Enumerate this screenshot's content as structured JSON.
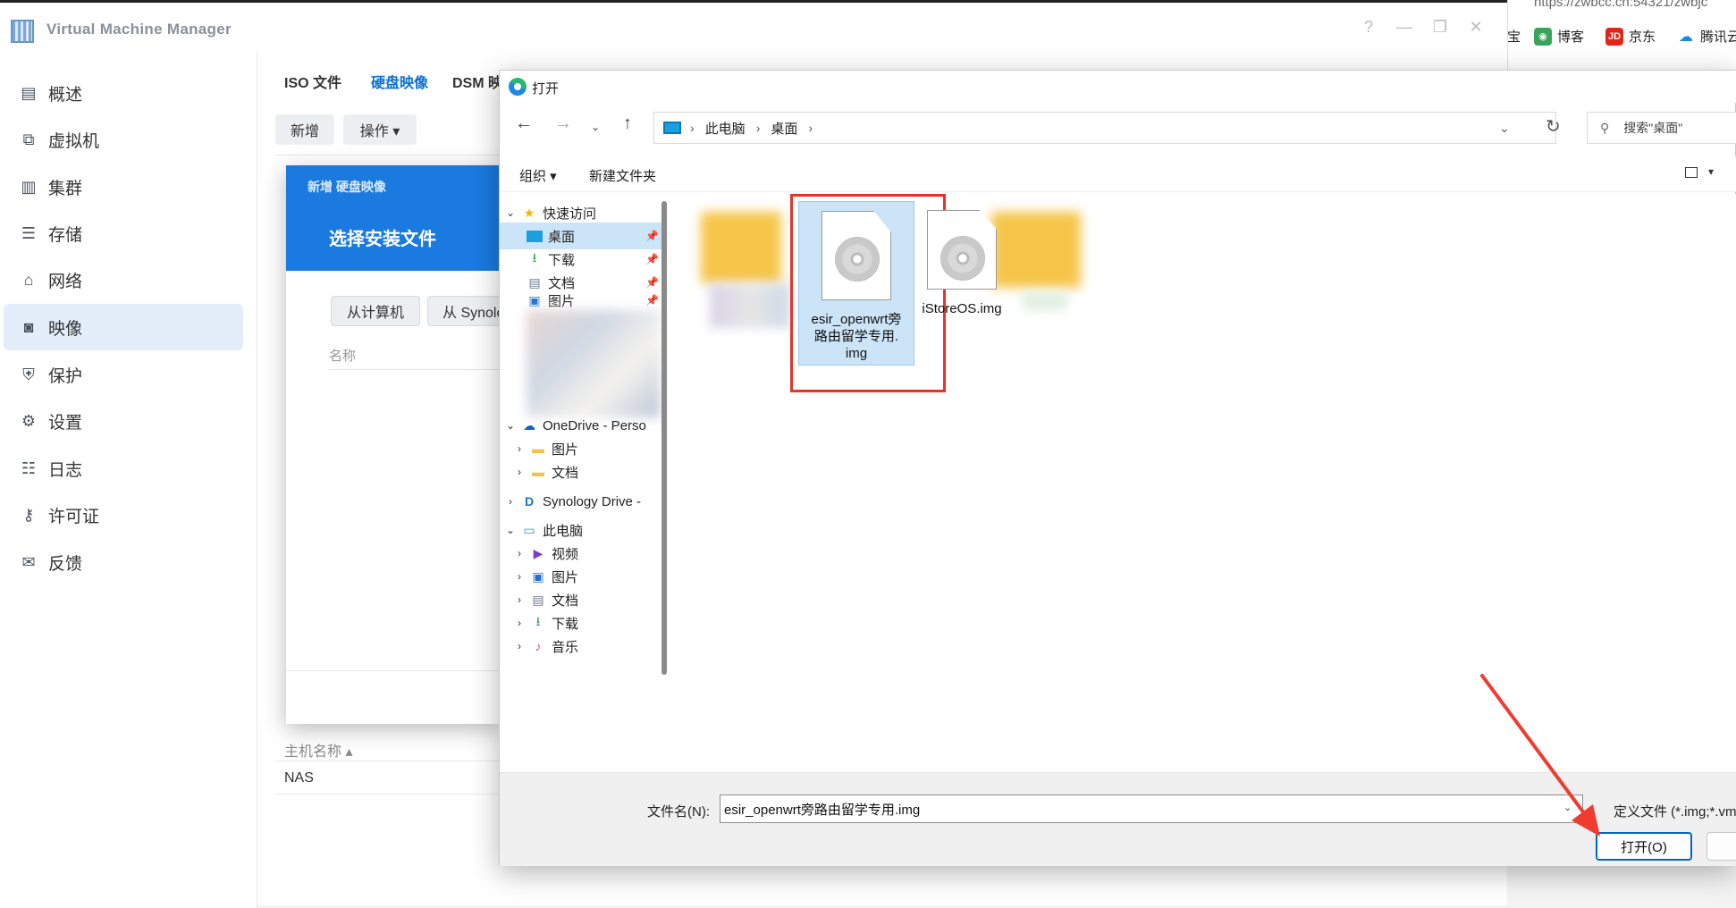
{
  "browser": {
    "url": "https://zwbcc.cn:54321/zwbjc",
    "bookmarks": [
      {
        "label": "宝",
        "icon": "bookmark-icon"
      },
      {
        "label": "博客",
        "icon": "cnblogs-icon"
      },
      {
        "label": "京东",
        "icon": "jd-icon",
        "badge": "JD"
      },
      {
        "label": "腾讯云",
        "icon": "tencent-cloud-icon"
      }
    ]
  },
  "vmm": {
    "title": "Virtual Machine Manager",
    "window_buttons": [
      "?",
      "—",
      "❐",
      "✕"
    ],
    "sidebar": [
      {
        "label": "概述",
        "icon": "overview-icon"
      },
      {
        "label": "虚拟机",
        "icon": "virtual-machine-icon"
      },
      {
        "label": "集群",
        "icon": "cluster-icon"
      },
      {
        "label": "存储",
        "icon": "storage-icon"
      },
      {
        "label": "网络",
        "icon": "network-icon"
      },
      {
        "label": "映像",
        "icon": "image-icon",
        "active": true
      },
      {
        "label": "保护",
        "icon": "shield-icon"
      },
      {
        "label": "设置",
        "icon": "gear-icon"
      },
      {
        "label": "日志",
        "icon": "log-list-icon"
      },
      {
        "label": "许可证",
        "icon": "key-icon"
      },
      {
        "label": "反馈",
        "icon": "mail-icon"
      }
    ],
    "tabs": [
      {
        "label": "ISO 文件"
      },
      {
        "label": "硬盘映像",
        "active": true
      },
      {
        "label": "DSM 映"
      }
    ],
    "toolbar": {
      "add": "新增",
      "actions": "操作 ▾"
    },
    "host_column": "主机名称 ▴",
    "host_value": "NAS"
  },
  "wizard": {
    "subtitle": "新增 硬盘映像",
    "title": "选择安装文件",
    "from_computer": "从计算机",
    "from_synology": "从 Synology NAS",
    "column_name": "名称"
  },
  "open_dialog": {
    "title": "打开",
    "breadcrumb": [
      "此电脑",
      "桌面"
    ],
    "search_placeholder": "搜索\"桌面\"",
    "commands": {
      "organize": "组织 ▾",
      "new_folder": "新建文件夹"
    },
    "tree": {
      "quick_access": "快速访问",
      "quick_items": [
        {
          "label": "桌面",
          "icon": "desktop-icon",
          "selected": true
        },
        {
          "label": "下载",
          "icon": "download-icon"
        },
        {
          "label": "文档",
          "icon": "document-icon"
        },
        {
          "label": "图片",
          "icon": "picture-icon"
        }
      ],
      "onedrive": "OneDrive - Perso",
      "onedrive_items": [
        {
          "label": "图片",
          "icon": "folder-icon"
        },
        {
          "label": "文档",
          "icon": "folder-icon"
        }
      ],
      "synology_drive": "Synology Drive -",
      "this_pc": "此电脑",
      "pc_items": [
        {
          "label": "视频",
          "icon": "video-icon"
        },
        {
          "label": "图片",
          "icon": "picture-icon"
        },
        {
          "label": "文档",
          "icon": "document-icon"
        },
        {
          "label": "下载",
          "icon": "download-icon"
        },
        {
          "label": "音乐",
          "icon": "music-icon"
        }
      ]
    },
    "files": [
      {
        "name": "esir_openwrt旁路由留学专用.img",
        "lines": [
          "esir_openwrt旁",
          "路由留学专用.",
          "img"
        ],
        "selected": true
      },
      {
        "name": "iStoreOS.img",
        "lines": [
          "iStoreOS.img"
        ]
      }
    ],
    "filename_label": "文件名(N):",
    "filename_value": "esir_openwrt旁路由留学专用.img",
    "filter": "定义文件 (*.img;*.vmdk",
    "open_button": "打开(O)",
    "accent": "#0067c0",
    "highlight_color": "#e8322a"
  }
}
